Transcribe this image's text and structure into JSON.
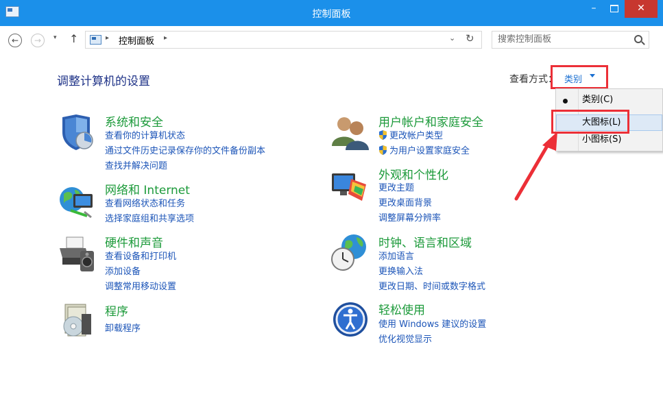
{
  "window": {
    "title": "控制面板",
    "minimize": "–",
    "close": "✕"
  },
  "nav": {
    "back": "←",
    "forward": "→",
    "recent": "▾",
    "up": "↑",
    "breadcrumb": "控制面板",
    "separator": "▸",
    "address_dropdown": "⌄",
    "refresh": "↻",
    "search_placeholder": "搜索控制面板"
  },
  "header": {
    "title": "调整计算机的设置",
    "view_label": "查看方式：",
    "view_value": "类别"
  },
  "view_menu": {
    "items": [
      {
        "label": "类别(C)",
        "selected": true
      },
      {
        "label": "大图标(L)",
        "highlighted": true
      },
      {
        "label": "小图标(S)"
      }
    ]
  },
  "categories": [
    {
      "title": "系统和安全",
      "icon": "shield-icon",
      "links": [
        "查看你的计算机状态",
        "通过文件历史记录保存你的文件备份副本",
        "查找并解决问题"
      ]
    },
    {
      "title": "网络和 Internet",
      "icon": "network-icon",
      "links": [
        "查看网络状态和任务",
        "选择家庭组和共享选项"
      ]
    },
    {
      "title": "硬件和声音",
      "icon": "printer-icon",
      "links": [
        "查看设备和打印机",
        "添加设备",
        "调整常用移动设置"
      ]
    },
    {
      "title": "程序",
      "icon": "programs-icon",
      "links": [
        "卸载程序"
      ]
    },
    {
      "title": "用户帐户和家庭安全",
      "icon": "users-icon",
      "links": [
        "更改帐户类型",
        "为用户设置家庭安全"
      ]
    },
    {
      "title": "外观和个性化",
      "icon": "appearance-icon",
      "links": [
        "更改主题",
        "更改桌面背景",
        "调整屏幕分辨率"
      ]
    },
    {
      "title": "时钟、语言和区域",
      "icon": "clock-globe-icon",
      "links": [
        "添加语言",
        "更换输入法",
        "更改日期、时间或数字格式"
      ]
    },
    {
      "title": "轻松使用",
      "icon": "ease-of-access-icon",
      "links": [
        "使用 Windows 建议的设置",
        "优化视觉显示"
      ]
    }
  ]
}
